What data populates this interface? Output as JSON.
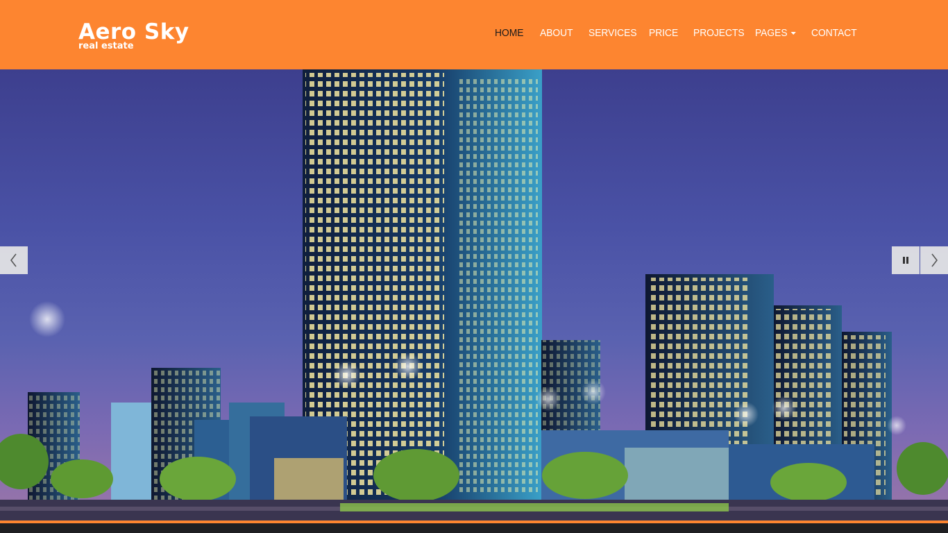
{
  "brand": {
    "name": "Aero Sky",
    "tagline": "real estate"
  },
  "nav": {
    "items": [
      {
        "label": "HOME",
        "active": true
      },
      {
        "label": "ABOUT"
      },
      {
        "label": "SERVICES"
      },
      {
        "label": "PRICE"
      },
      {
        "label": "PROJECTS"
      },
      {
        "label": "PAGES",
        "dropdown": true
      },
      {
        "label": "CONTACT"
      }
    ]
  },
  "slider": {
    "image": "night city skyline with illuminated skyscrapers",
    "prev_icon": "chevron-left-icon",
    "pause_icon": "pause-icon",
    "next_icon": "chevron-right-icon"
  },
  "colors": {
    "accent": "#fd8530",
    "active_nav": "#1a1a1a",
    "sky_top": "#3d3f8e",
    "sky_bottom": "#9b76a8"
  }
}
